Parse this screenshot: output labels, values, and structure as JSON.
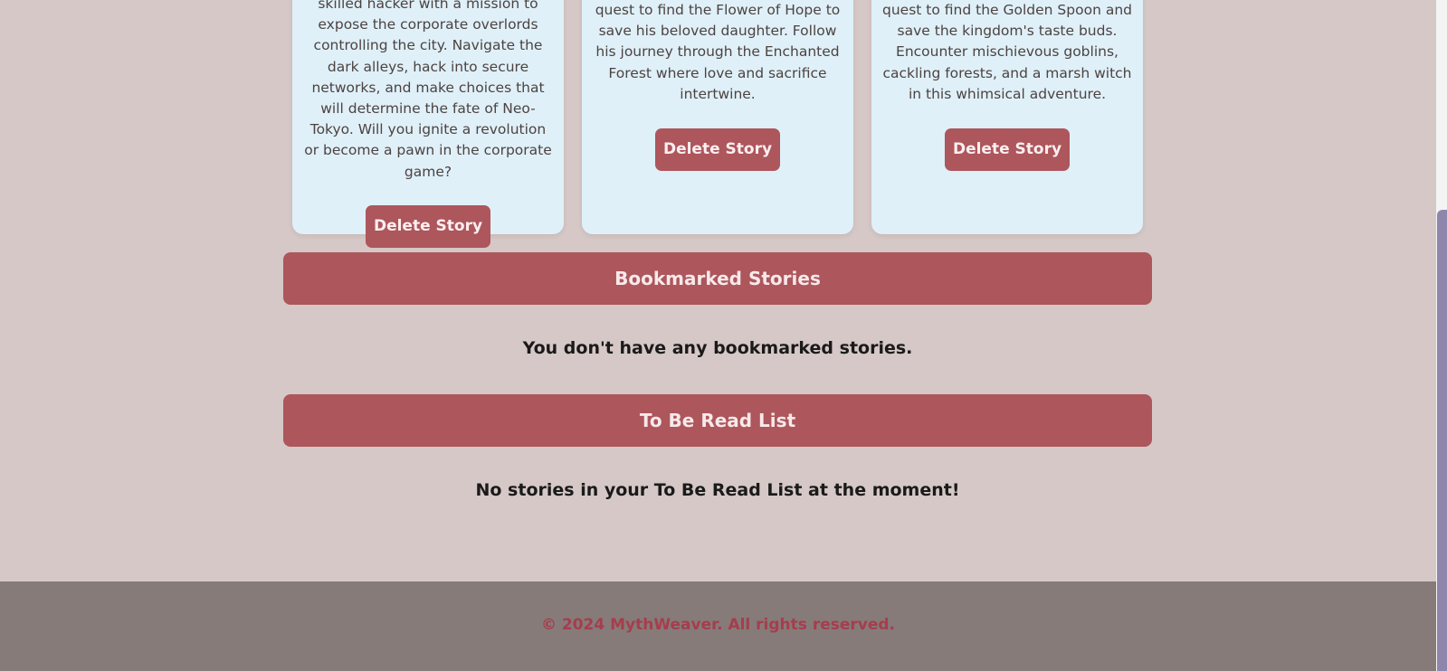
{
  "stories": [
    {
      "description": "skilled hacker with a mission to expose the corporate overlords controlling the city. Navigate the dark alleys, hack into secure networks, and make choices that will determine the fate of Neo-Tokyo. Will you ignite a revolution or become a pawn in the corporate game?",
      "delete_label": "Delete Story"
    },
    {
      "description": "quest to find the Flower of Hope to save his beloved daughter. Follow his journey through the Enchanted Forest where love and sacrifice intertwine.",
      "delete_label": "Delete Story"
    },
    {
      "description": "quest to find the Golden Spoon and save the kingdom's taste buds. Encounter mischievous goblins, cackling forests, and a marsh witch in this whimsical adventure.",
      "delete_label": "Delete Story"
    }
  ],
  "bookmarked": {
    "title": "Bookmarked Stories",
    "empty_message": "You don't have any bookmarked stories."
  },
  "tbr": {
    "title": "To Be Read List",
    "empty_message": "No stories in your To Be Read List at the moment!"
  },
  "footer": {
    "text": "© 2024 MythWeaver. All rights reserved."
  },
  "colors": {
    "background": "#d5c8c6",
    "card": "#dff0f9",
    "accent": "#ad565c",
    "footer": "#867b79",
    "footer_text": "#a63d4d"
  }
}
